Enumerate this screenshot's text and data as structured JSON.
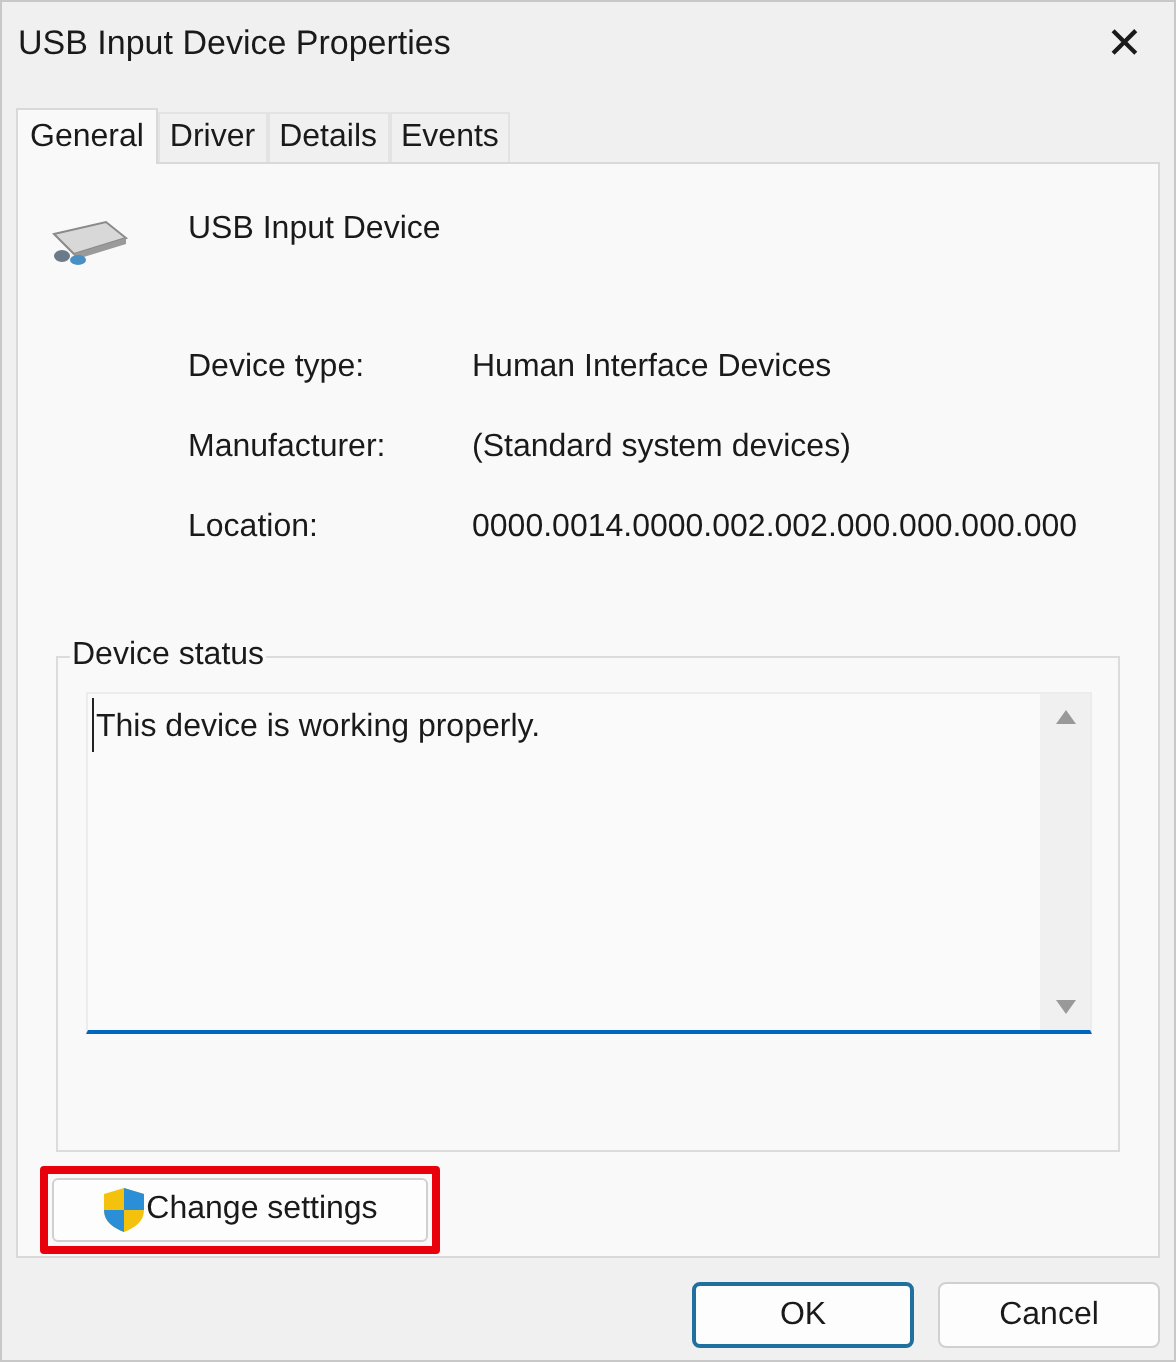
{
  "window": {
    "title": "USB Input Device Properties",
    "close": "✕"
  },
  "tabs": [
    {
      "label": "General",
      "selected": true
    },
    {
      "label": "Driver",
      "selected": false
    },
    {
      "label": "Details",
      "selected": false
    },
    {
      "label": "Events",
      "selected": false
    }
  ],
  "device_name": "USB Input Device",
  "properties": [
    {
      "label": "Device type:",
      "value": "Human Interface Devices"
    },
    {
      "label": "Manufacturer:",
      "value": "(Standard system devices)"
    },
    {
      "label": "Location:",
      "value": "0000.0014.0000.002.002.000.000.000.000"
    }
  ],
  "device_status": {
    "title": "Device status",
    "text": "This device is working properly."
  },
  "change_settings": {
    "label": "Change settings",
    "highlighted": true
  },
  "buttons": [
    {
      "label": "OK",
      "default": true
    },
    {
      "label": "Cancel",
      "default": false
    }
  ]
}
